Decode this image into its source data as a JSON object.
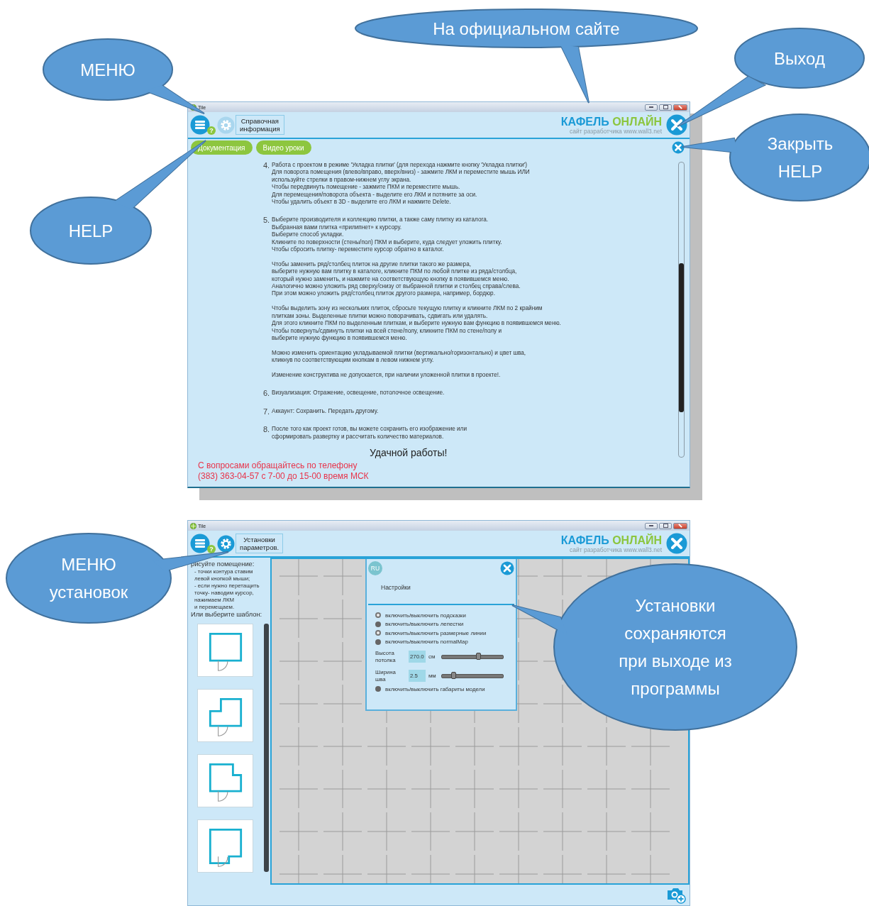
{
  "windows": [
    {
      "kind": "help",
      "title": "Tile",
      "help_badge": "?",
      "gear_selected": false,
      "section_label": [
        "Справочная",
        "информация"
      ],
      "logo": {
        "first": "КАФЕЛЬ",
        "second": "ОНЛАЙН",
        "subtitle": "сайт разработчика www.wall3.net"
      },
      "tabs": [
        "Документация",
        "Видео уроки"
      ],
      "items": [
        {
          "number": "4.",
          "paragraphs": [
            [
              "Работа с проектом в режиме 'Укладка плитки' (для перехода нажмите кнопку 'Укладка плитки')",
              "Для поворота помещения (влево/вправо, вверх/вниз) - зажмите ЛКМ и переместите мышь   ИЛИ",
              "используйте стрелки в правом-нижнем углу экрана.",
              "Чтобы передвинуть помещение - зажмите ПКМ и переместите мышь.",
              "Для перемещения/поворота объекта - выделите его ЛКМ и потяните за оси.",
              "Чтобы удалить объект в 3D - выделите его ЛКМ и нажмите Delete."
            ]
          ]
        },
        {
          "number": "5.",
          "paragraphs": [
            [
              "Выберите производителя и коллекцию плитки, а также саму плитку из каталога.",
              "Выбранная вами плитка «прилипнет» к курсору.",
              "Выберите способ укладки.",
              "Кликните по поверхности (стены/пол) ПКМ и выберите, куда следует уложить плитку.",
              "Чтобы сбросить плитку- переместите курсор обратно в каталог."
            ],
            [
              "Чтобы заменить ряд/столбец плиток на другие плитки такого же размера,",
              "выберите нужную вам плитку в каталоге, кликните ПКМ по любой плитке из ряда/столбца,",
              "который нужно заменить, и нажмите на соответствующую кнопку в появившемся меню.",
              "Аналогично можно уложить ряд сверху/снизу от выбранной плитки и столбец справа/слева.",
              "При этом можно уложить ряд/столбец плиток другого размера, например, бордюр."
            ],
            [
              "Чтобы выделить зону из нескольких плиток, сбросьте текущую плитку и кликните ЛКМ по 2 крайним",
              "плиткам зоны. Выделенные плитки можно поворачивать, сдвигать или удалять.",
              "Для этого кликните ПКМ по выделенным плиткам, и выберите нужную вам функцию в появившемся меню.",
              "Чтобы повернуть/сдвинуть плитки на всей стене/полу, кликните ПКМ по стене/полу и",
              "выберите нужную функцию в появившемся меню."
            ],
            [
              "Можно изменить ориентацию укладываемой плитки (вертикально/горизонтально) и цвет шва,",
              "кликнув по соответствующим кнопкам в левом нижнем углу."
            ],
            [
              "Изменение конструктива не допускается, при наличии уложенной плитки в проекте!."
            ]
          ]
        },
        {
          "number": "6.",
          "paragraphs": [
            [
              "Визуализация: Отражение, освещение, потолочное освещение."
            ]
          ]
        },
        {
          "number": "7.",
          "paragraphs": [
            [
              "Аккаунт: Сохранить. Передать другому."
            ]
          ]
        },
        {
          "number": "8.",
          "paragraphs": [
            [
              "После того как проект готов, вы можете сохранить его изображение или",
              "сформировать развертку и рассчитать количество материалов."
            ]
          ]
        }
      ],
      "closing": "Удачной работы!",
      "contact": [
        "С вопросами обращайтесь по телефону",
        "(383) 363-04-57 с 7-00 до 15-00 время МСК"
      ]
    },
    {
      "kind": "settings",
      "title": "Tile",
      "help_badge": "?",
      "gear_selected": true,
      "section_label": [
        "Установки",
        "параметров."
      ],
      "logo": {
        "first": "КАФЕЛЬ",
        "second": "ОНЛАЙН",
        "subtitle": "сайт разработчика www.wall3.net"
      },
      "instructions": {
        "heading": "рисуйте помещение:",
        "lines": [
          "- точки контура ставим",
          "левой кнопкой мыши;",
          "- если нужно перетащить",
          "точку- наводим курсор,",
          "нажимаем ЛКМ",
          "и перемещаем."
        ],
        "prompt": "Или выберите шаблон:"
      },
      "templates": [
        {
          "kind": "square"
        },
        {
          "kind": "notch_top_left"
        },
        {
          "kind": "notch_right"
        },
        {
          "kind": "notch_bottom"
        }
      ],
      "panel": {
        "language": "RU",
        "title": "Настройки",
        "rows": [
          {
            "kind": "toggle",
            "label": "включить/выключить подсказки",
            "on": true
          },
          {
            "kind": "toggle",
            "label": "включить/выключить лепестки",
            "on": false
          },
          {
            "kind": "toggle",
            "label": "включить/выключить размерные линии",
            "on": true
          },
          {
            "kind": "toggle",
            "label": "включить/выключить normalMap",
            "on": false
          },
          {
            "kind": "slider",
            "label": [
              "Высота",
              "потолка"
            ],
            "value": "270.0",
            "unit": "см",
            "level": 0.59
          },
          {
            "kind": "slider",
            "label": [
              "Ширина",
              "шва"
            ],
            "value": "2.5",
            "unit": "мм",
            "level": 0.19
          },
          {
            "kind": "toggle",
            "label": "включить/выключить габариты модели",
            "on": false
          }
        ]
      }
    }
  ],
  "callouts": [
    {
      "lines": [
        "На официальном сайте"
      ]
    },
    {
      "lines": [
        "МЕНЮ"
      ]
    },
    {
      "lines": [
        "Выход"
      ]
    },
    {
      "lines": [
        "Закрыть",
        "HELP"
      ]
    },
    {
      "lines": [
        "HELP"
      ]
    },
    {
      "lines": [
        "МЕНЮ",
        "установок"
      ]
    },
    {
      "lines": [
        "Установки",
        "сохраняются",
        "при выходе из",
        "программы"
      ]
    }
  ]
}
